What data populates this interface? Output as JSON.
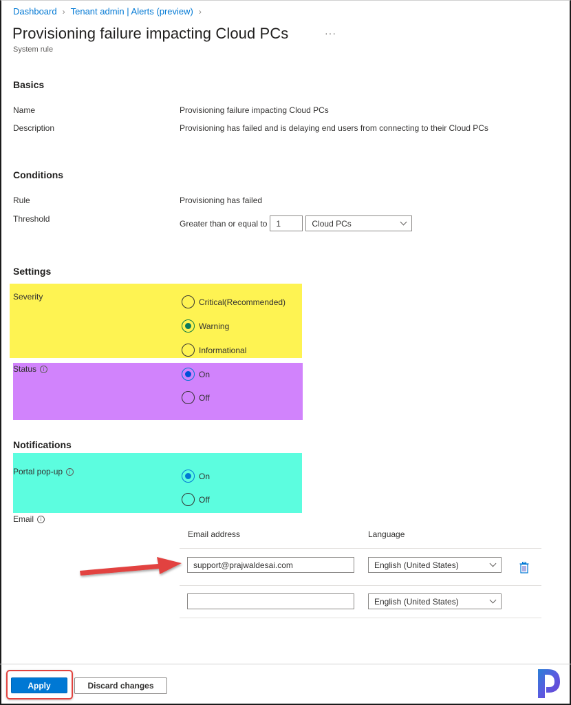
{
  "breadcrumb": [
    {
      "label": "Dashboard"
    },
    {
      "label": "Tenant admin | Alerts (preview)"
    }
  ],
  "header": {
    "title": "Provisioning failure impacting Cloud PCs",
    "more_label": "···",
    "subtitle": "System rule"
  },
  "basics": {
    "heading": "Basics",
    "name_label": "Name",
    "name_value": "Provisioning failure impacting Cloud PCs",
    "description_label": "Description",
    "description_value": "Provisioning has failed and is delaying end users from connecting to their Cloud PCs"
  },
  "conditions": {
    "heading": "Conditions",
    "rule_label": "Rule",
    "rule_value": "Provisioning has failed",
    "threshold_label": "Threshold",
    "threshold_operator": "Greater than or equal to",
    "threshold_value": "1",
    "threshold_unit": "Cloud PCs"
  },
  "settings": {
    "heading": "Settings",
    "severity_label": "Severity",
    "severity_options": [
      {
        "label": "Critical(Recommended)",
        "checked": false
      },
      {
        "label": "Warning",
        "checked": true
      },
      {
        "label": "Informational",
        "checked": false
      }
    ],
    "status_label": "Status",
    "status_options": [
      {
        "label": "On",
        "checked": true
      },
      {
        "label": "Off",
        "checked": false
      }
    ]
  },
  "notifications": {
    "heading": "Notifications",
    "portal_popup_label": "Portal pop-up",
    "portal_popup_options": [
      {
        "label": "On",
        "checked": true
      },
      {
        "label": "Off",
        "checked": false
      }
    ],
    "email_label": "Email",
    "email_table": {
      "col_email": "Email address",
      "col_language": "Language",
      "rows": [
        {
          "email": "support@prajwaldesai.com",
          "language": "English (United States)"
        },
        {
          "email": "",
          "language": "English (United States)"
        }
      ]
    }
  },
  "footer": {
    "apply_label": "Apply",
    "discard_label": "Discard changes"
  },
  "colors": {
    "accent": "#0078d4",
    "highlight_severity": "#fef352",
    "highlight_status": "#d183fc",
    "highlight_notifications": "#5cfddf",
    "annotation_red": "#e2433f"
  },
  "icons": {
    "info": "info-icon",
    "delete": "trash-icon",
    "chevron": "chevron-down-icon"
  },
  "info_glyph": "i"
}
